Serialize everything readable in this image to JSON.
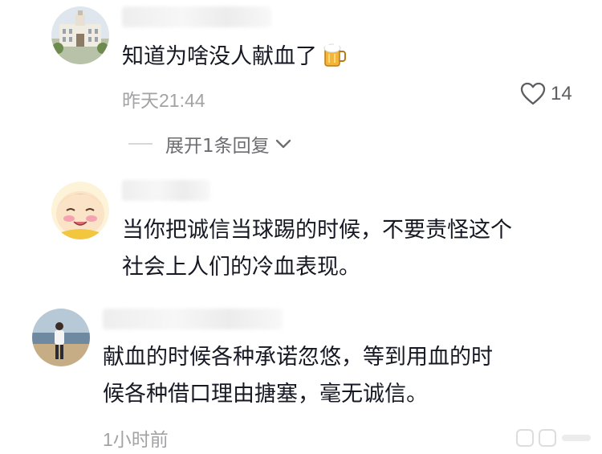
{
  "comments": [
    {
      "text_lines": [
        "知道为啥没人献血了"
      ],
      "time": "昨天21:44",
      "like_count": "14",
      "reply_expand": "展开1条回复",
      "emoji_icon": "beer-mug-icon"
    },
    {
      "text_lines": [
        "当你把诚信当球踢的时候，不要责怪这个",
        "社会上人们的冷血表现。"
      ]
    },
    {
      "text_lines": [
        "献血的时候各种承诺忽悠，等到用血的时",
        "候各种借口理由搪塞，毫无诚信。"
      ],
      "time": "1小时前"
    }
  ],
  "colors": {
    "text": "#161823",
    "meta": "#a3a3a6",
    "like": "#5e5e62"
  }
}
